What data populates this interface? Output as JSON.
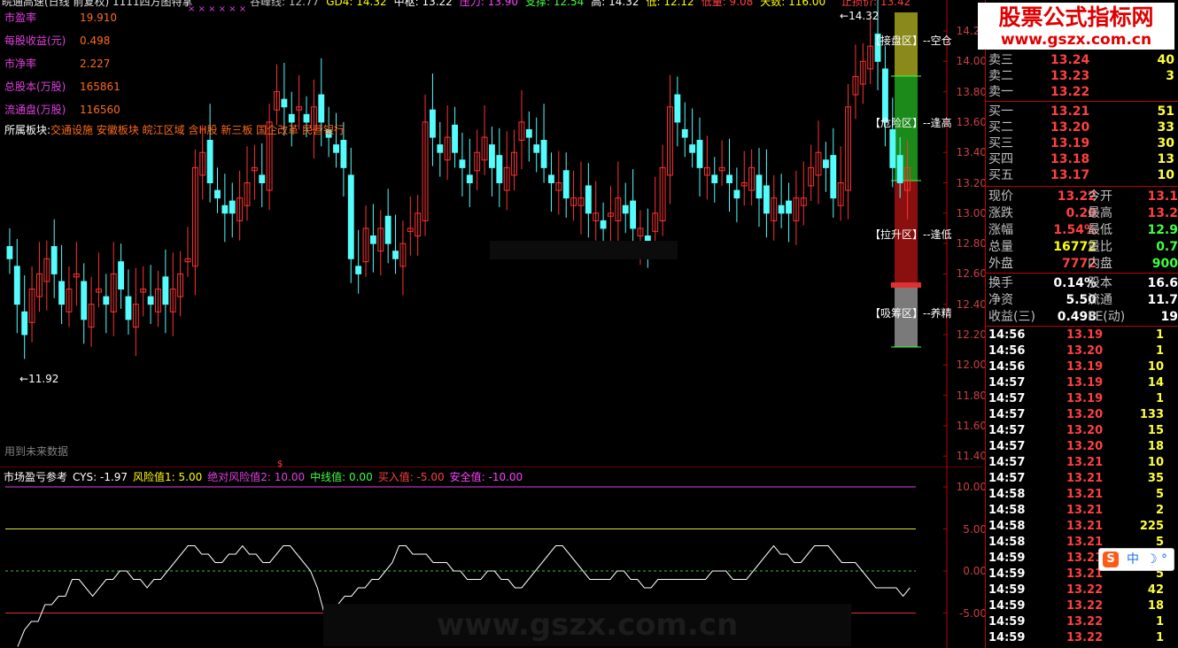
{
  "colors": {
    "up": "#ff3232",
    "down": "#54fcfc",
    "bg": "#000000",
    "axis_red": "#c00000",
    "gold": "#ff6a1a",
    "magenta": "#e040e0",
    "white": "#ffffff"
  },
  "header": {
    "title": "皖通高速(日线 前复权) 1111四方图特掌",
    "marks": "×   ×   ×   ×   ×   ×",
    "items": [
      {
        "label": "谷峰线: 12.77",
        "color": "#c0c0c0"
      },
      {
        "label": "GD4: 14.32",
        "color": "#ffff00"
      },
      {
        "label": "中枢: 13.22",
        "color": "#ffffff"
      },
      {
        "label": "压力: 13.90",
        "color": "#ff40ff"
      },
      {
        "label": "支撑: 12.54",
        "color": "#40ff40"
      },
      {
        "label": "高: 14.32",
        "color": "#ffffff"
      },
      {
        "label": "低: 12.12",
        "color": "#ffff00"
      },
      {
        "label": "低量: 9.08",
        "color": "#ff4040"
      },
      {
        "label": "天数: 116.00",
        "color": "#ffff00"
      }
    ],
    "stop_price": "止损价: 13.42"
  },
  "fundamentals": [
    {
      "label": "市盈率",
      "value": "19.910"
    },
    {
      "label": "每股收益(元)",
      "value": "0.498"
    },
    {
      "label": "市净率",
      "value": "2.227"
    },
    {
      "label": "总股本(万股)",
      "value": "165861"
    },
    {
      "label": "流通盘(万股)",
      "value": "116560"
    }
  ],
  "sectors": {
    "label": "所属板块:",
    "value": "交通设施 安徽板块 皖江区域 含H股 新三板 国企改革 民营银行"
  },
  "future_data_note": "用到未来数据",
  "price_marks": {
    "high": "14.32",
    "low": "11.92"
  },
  "zones": [
    {
      "label": "【接盘区】",
      "suffix": "--空仓"
    },
    {
      "label": "【危险区】",
      "suffix": "--逢高"
    },
    {
      "label": "【拉升区】",
      "suffix": "--逢低"
    },
    {
      "label": "【吸筹区】",
      "suffix": "--养精"
    }
  ],
  "price_axis": [
    "14.20",
    "14.00",
    "13.80",
    "13.60",
    "13.40",
    "13.20",
    "13.00",
    "12.80",
    "12.60",
    "12.40",
    "12.20",
    "12.00",
    "11.80",
    "11.60",
    "11.40"
  ],
  "cys_axis": [
    "10.00",
    "5.00",
    "0.00",
    "-5.00"
  ],
  "watermark": {
    "brand": "股票公式指标网",
    "url": "www.gszx.com.cn"
  },
  "indicator": {
    "name": "市场盈亏参考",
    "items": [
      {
        "label": "CYS: -1.97",
        "color": "#ffffff"
      },
      {
        "label": "风险值1: 5.00",
        "color": "#ffff00"
      },
      {
        "label": "绝对风险值2: 10.00",
        "color": "#e040e0"
      },
      {
        "label": "中线值: 0.00",
        "color": "#40ff40"
      },
      {
        "label": "买入值: -5.00",
        "color": "#ff4040"
      },
      {
        "label": "安全值: -10.00",
        "color": "#ff40ff"
      }
    ],
    "marker": "$"
  },
  "order_book": {
    "asks": [
      {
        "label": "卖三",
        "price": "13.24",
        "vol": "40"
      },
      {
        "label": "卖二",
        "price": "13.23",
        "vol": "3"
      },
      {
        "label": "卖一",
        "price": "13.22",
        "vol": ""
      }
    ],
    "bids": [
      {
        "label": "买一",
        "price": "13.21",
        "vol": "51"
      },
      {
        "label": "买二",
        "price": "13.20",
        "vol": "33"
      },
      {
        "label": "买三",
        "price": "13.19",
        "vol": "30"
      },
      {
        "label": "买四",
        "price": "13.18",
        "vol": "13"
      },
      {
        "label": "买五",
        "price": "13.17",
        "vol": "10"
      }
    ]
  },
  "quote": [
    {
      "l1": "现价",
      "v1": "13.22",
      "c1": "#ff4040",
      "l2": "今开",
      "v2": "13.1",
      "c2": "#ff4040"
    },
    {
      "l1": "涨跌",
      "v1": "0.20",
      "c1": "#ff4040",
      "l2": "最高",
      "v2": "13.2",
      "c2": "#ff4040"
    },
    {
      "l1": "涨幅",
      "v1": "1.54%",
      "c1": "#ff4040",
      "l2": "最低",
      "v2": "12.9",
      "c2": "#40ff40"
    },
    {
      "l1": "总量",
      "v1": "16772",
      "c1": "#ffff00",
      "l2": "量比",
      "v2": "0.7",
      "c2": "#40ff40"
    },
    {
      "l1": "外盘",
      "v1": "7772",
      "c1": "#ff4040",
      "l2": "内盘",
      "v2": "900",
      "c2": "#40ff40"
    }
  ],
  "stats": [
    {
      "l1": "换手",
      "v1": "0.14%",
      "l2": "股本",
      "v2": "16.6"
    },
    {
      "l1": "净资",
      "v1": "5.50",
      "l2": "流通",
      "v2": "11.7"
    },
    {
      "l1": "收益(三)",
      "v1": "0.498",
      "l2": "PE(动)",
      "v2": "19"
    }
  ],
  "ticks": [
    {
      "time": "14:56",
      "price": "13.19",
      "vol": "1"
    },
    {
      "time": "14:56",
      "price": "13.20",
      "vol": "1"
    },
    {
      "time": "14:56",
      "price": "13.19",
      "vol": "10"
    },
    {
      "time": "14:57",
      "price": "13.19",
      "vol": "14"
    },
    {
      "time": "14:57",
      "price": "13.19",
      "vol": "1"
    },
    {
      "time": "14:57",
      "price": "13.20",
      "vol": "133"
    },
    {
      "time": "14:57",
      "price": "13.20",
      "vol": "15"
    },
    {
      "time": "14:57",
      "price": "13.20",
      "vol": "18"
    },
    {
      "time": "14:57",
      "price": "13.21",
      "vol": "10"
    },
    {
      "time": "14:57",
      "price": "13.21",
      "vol": "35"
    },
    {
      "time": "14:58",
      "price": "13.21",
      "vol": "5"
    },
    {
      "time": "14:58",
      "price": "13.21",
      "vol": "2"
    },
    {
      "time": "14:58",
      "price": "13.21",
      "vol": "225"
    },
    {
      "time": "14:58",
      "price": "13.21",
      "vol": "5"
    },
    {
      "time": "14:59",
      "price": "13.21",
      "vol": ""
    },
    {
      "time": "14:59",
      "price": "13.21",
      "vol": "5"
    },
    {
      "time": "14:59",
      "price": "13.22",
      "vol": "42"
    },
    {
      "time": "14:59",
      "price": "13.22",
      "vol": "18"
    },
    {
      "time": "14:59",
      "price": "13.22",
      "vol": "1"
    },
    {
      "time": "14:59",
      "price": "13.22",
      "vol": "1"
    }
  ],
  "ime": {
    "logo": "S",
    "mode": "中"
  }
}
